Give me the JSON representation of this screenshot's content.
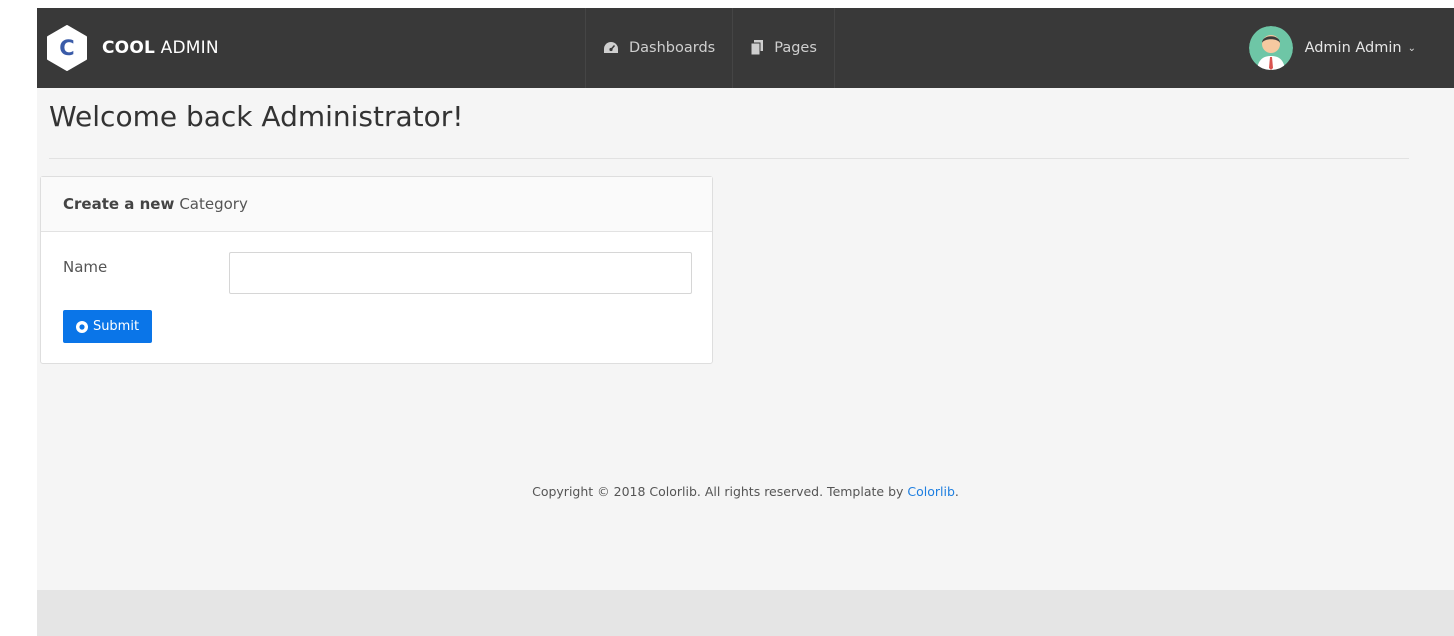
{
  "brand": {
    "letter": "C",
    "bold": "COOL",
    "light": "ADMIN"
  },
  "nav": {
    "items": [
      {
        "label": "Dashboards",
        "icon": "tachometer-icon"
      },
      {
        "label": "Pages",
        "icon": "copy-icon"
      }
    ]
  },
  "account": {
    "name": "Admin Admin",
    "caret": "⌄"
  },
  "page": {
    "welcome": "Welcome back Administrator!"
  },
  "card": {
    "title_bold": "Create a new",
    "title_rest": "Category",
    "name_label": "Name",
    "name_value": "",
    "submit_label": "Submit"
  },
  "footer": {
    "text": "Copyright © 2018 Colorlib. All rights reserved. Template by ",
    "link": "Colorlib",
    "suffix": "."
  },
  "colors": {
    "topbar": "#393939",
    "primary_button": "#0a75e8",
    "link": "#1f7fe0",
    "background": "#f5f5f5"
  }
}
